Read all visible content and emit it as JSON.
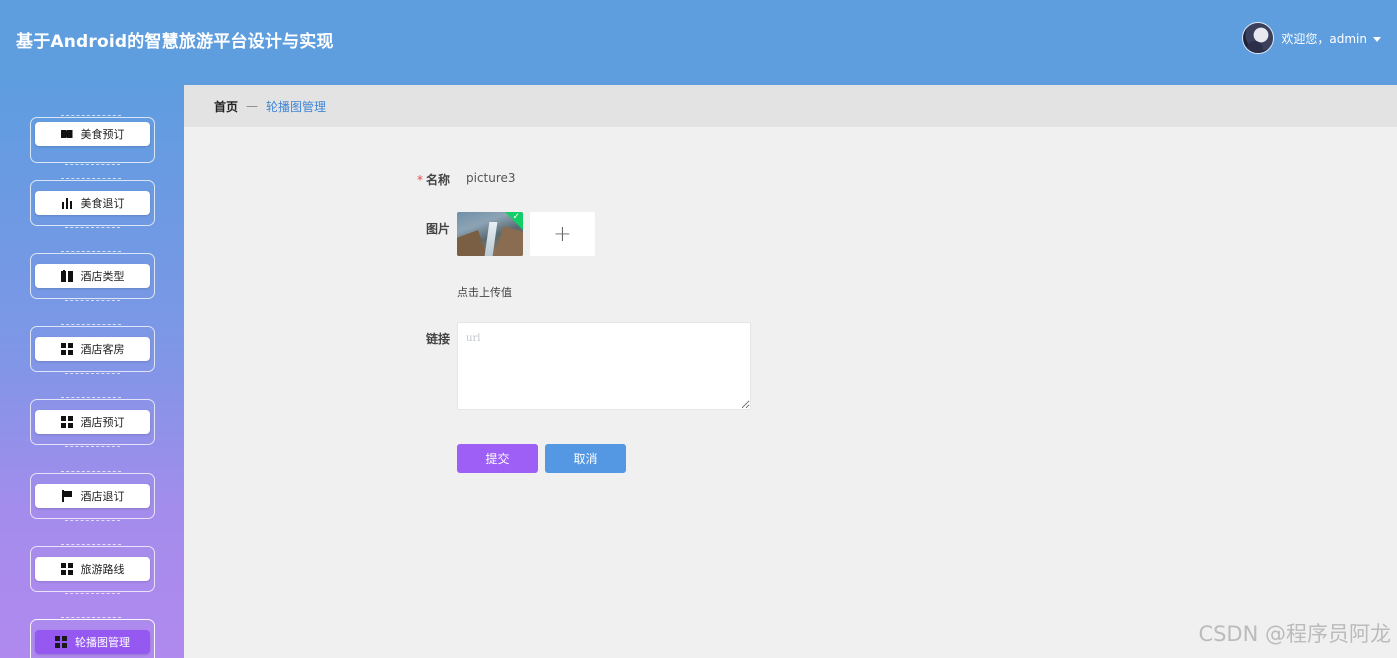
{
  "header": {
    "title": "基于Android的智慧旅游平台设计与实现",
    "welcome": "欢迎您，admin"
  },
  "sidebar": {
    "items": [
      {
        "label": "美食预订",
        "icon": "ticket-icon"
      },
      {
        "label": "美食退订",
        "icon": "bar-chart-icon"
      },
      {
        "label": "酒店类型",
        "icon": "book-icon"
      },
      {
        "label": "酒店客房",
        "icon": "grid-icon"
      },
      {
        "label": "酒店预订",
        "icon": "grid-icon"
      },
      {
        "label": "酒店退订",
        "icon": "flag-icon"
      },
      {
        "label": "旅游路线",
        "icon": "grid-icon"
      },
      {
        "label": "轮播图管理",
        "icon": "grid-icon",
        "active": true
      }
    ]
  },
  "breadcrumb": {
    "home": "首页",
    "separator": "—",
    "current": "轮播图管理"
  },
  "form": {
    "name_label": "名称",
    "name_value": "picture3",
    "image_label": "图片",
    "upload_hint": "点击上传值",
    "link_label": "链接",
    "link_placeholder": "url",
    "submit_label": "提交",
    "cancel_label": "取消"
  },
  "watermark": "CSDN @程序员阿龙",
  "colors": {
    "header": "#5e9edf",
    "active_menu": "#9559f2",
    "submit": "#9d5ff5",
    "cancel": "#5497e3",
    "crumb_link": "#3f86d8"
  }
}
